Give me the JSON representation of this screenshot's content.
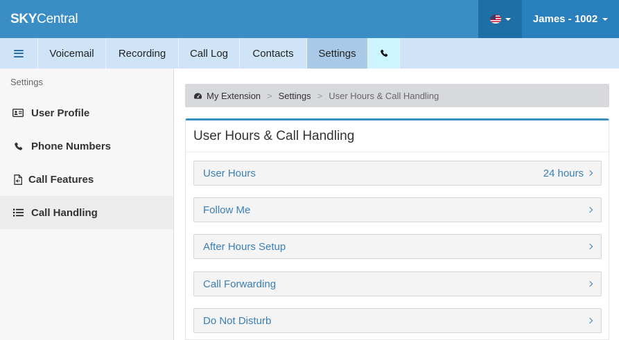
{
  "header": {
    "brand_bold": "SKY",
    "brand_rest": "Central",
    "user_label": "James - 1002"
  },
  "nav": {
    "items": [
      {
        "label": "Voicemail"
      },
      {
        "label": "Recording"
      },
      {
        "label": "Call Log"
      },
      {
        "label": "Contacts"
      },
      {
        "label": "Settings",
        "active": true
      }
    ],
    "menu_icon": "hamburger-icon",
    "phone_icon": "phone-icon"
  },
  "sidebar": {
    "heading": "Settings",
    "items": [
      {
        "label": "User Profile",
        "icon": "id-card-icon"
      },
      {
        "label": "Phone Numbers",
        "icon": "phone-icon"
      },
      {
        "label": "Call Features",
        "icon": "file-audio-icon"
      },
      {
        "label": "Call Handling",
        "icon": "list-icon",
        "active": true
      }
    ]
  },
  "breadcrumb": {
    "root": "My Extension",
    "middle": "Settings",
    "current": "User Hours & Call Handling",
    "separator": ">"
  },
  "panel": {
    "title": "User Hours & Call Handling",
    "rows": [
      {
        "label": "User Hours",
        "value": "24 hours"
      },
      {
        "label": "Follow Me",
        "value": ""
      },
      {
        "label": "After Hours Setup",
        "value": ""
      },
      {
        "label": "Call Forwarding",
        "value": ""
      },
      {
        "label": "Do Not Disturb",
        "value": ""
      }
    ]
  },
  "colors": {
    "header_bg": "#3a8ec5",
    "nav_bg": "#cfe5f7",
    "link": "#3a7fb5"
  }
}
